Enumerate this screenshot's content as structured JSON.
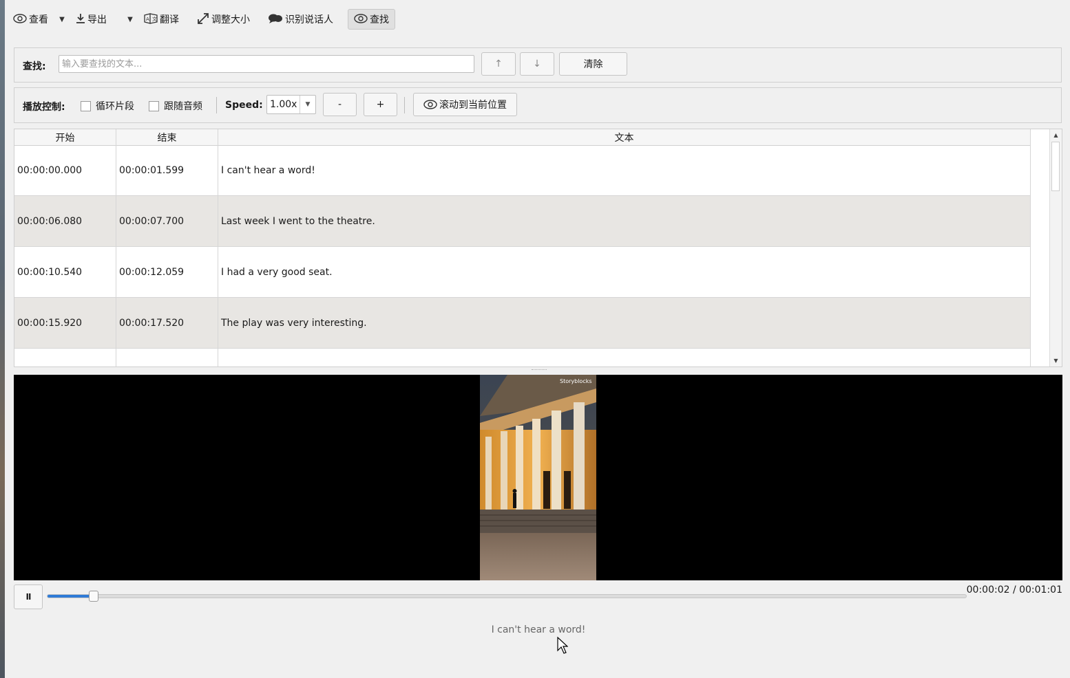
{
  "toolbar": {
    "view_label": "查看",
    "export_label": "导出",
    "translate_label": "翻译",
    "resize_label": "调整大小",
    "speaker_label": "识别说话人",
    "find_label": "查找",
    "icons": {
      "view": "eye-icon",
      "export": "download-icon",
      "translate": "translate-icon",
      "resize": "resize-icon",
      "speaker": "speech-bubble-icon",
      "find": "eye-icon",
      "dropdown": "chevron-down-icon"
    }
  },
  "search": {
    "label": "查找:",
    "placeholder": "输入要查找的文本...",
    "value": "",
    "prev_label": "↑",
    "next_label": "↓",
    "clear_label": "清除"
  },
  "playback": {
    "label": "播放控制:",
    "loop_label": "循环片段",
    "loop_checked": false,
    "follow_label": "跟随音频",
    "follow_checked": false,
    "speed_label": "Speed:",
    "speed_value": "1.00x",
    "minus_label": "-",
    "plus_label": "+",
    "scroll_label": "滚动到当前位置"
  },
  "table": {
    "columns": [
      "开始",
      "结束",
      "文本"
    ],
    "rows": [
      {
        "start": "00:00:00.000",
        "end": "00:00:01.599",
        "text": "I can't hear a word!"
      },
      {
        "start": "00:00:06.080",
        "end": "00:00:07.700",
        "text": "Last week I went to the theatre."
      },
      {
        "start": "00:00:10.540",
        "end": "00:00:12.059",
        "text": "I had a very good seat."
      },
      {
        "start": "00:00:15.920",
        "end": "00:00:17.520",
        "text": "The play was very interesting."
      },
      {
        "start": "",
        "end": "",
        "text": ""
      }
    ]
  },
  "player": {
    "pause_label": "II",
    "progress": 0.05,
    "time_text": "00:00:02 / 00:01:01",
    "current_subtitle": "I can't hear a word!"
  },
  "colors": {
    "accent": "#2f7bd6",
    "alt_row": "#e8e6e3",
    "background": "#f0f0f0"
  }
}
